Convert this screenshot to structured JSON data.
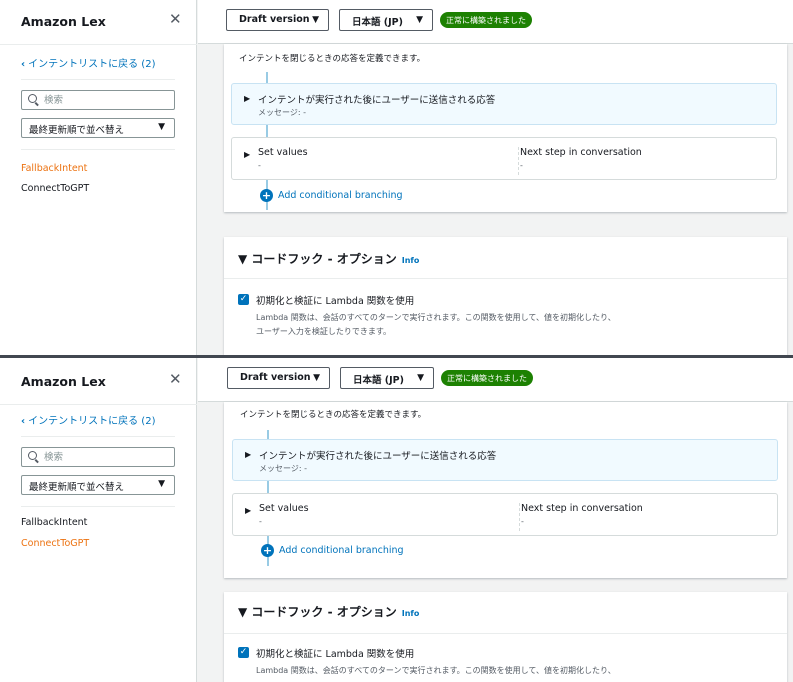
{
  "panels": [
    {
      "sidebar": {
        "title": "Amazon Lex",
        "close": "✕",
        "back_link": "インテントリストに戻る (2)",
        "search_placeholder": "検索",
        "sort_value": "最終更新順で並べ替え",
        "intents": [
          "FallbackIntent",
          "ConnectToGPT"
        ],
        "active_intent": "FallbackIntent"
      },
      "header": {
        "version": "Draft version",
        "language": "日本語 (JP)",
        "status": "正常に構築されました"
      },
      "closing": {
        "description": "インテントを閉じるときの応答を定義できます。",
        "response_title": "インテントが実行された後にユーザーに送信される応答",
        "response_message": "メッセージ: -",
        "set_values_label": "Set values",
        "set_values_value": "-",
        "next_step_label": "Next step in conversation",
        "next_step_value": "-",
        "add_branching": "Add conditional branching"
      },
      "codehook": {
        "title": "コードフック - オプション",
        "info": "Info",
        "checkbox_label": "初期化と検証に Lambda 関数を使用",
        "checkbox_desc_1": "Lambda 関数は、会話のすべてのターンで実行されます。この関数を使用して、値を初期化したり、",
        "checkbox_desc_2": "ユーザー入力を検証したりできます。"
      }
    },
    {
      "sidebar": {
        "title": "Amazon Lex",
        "close": "✕",
        "back_link": "インテントリストに戻る (2)",
        "search_placeholder": "検索",
        "sort_value": "最終更新順で並べ替え",
        "intents": [
          "FallbackIntent",
          "ConnectToGPT"
        ],
        "active_intent": "ConnectToGPT"
      },
      "header": {
        "version": "Draft version",
        "language": "日本語 (JP)",
        "status": "正常に構築されました"
      },
      "closing": {
        "description": "インテントを閉じるときの応答を定義できます。",
        "response_title": "インテントが実行された後にユーザーに送信される応答",
        "response_message": "メッセージ: -",
        "set_values_label": "Set values",
        "set_values_value": "-",
        "next_step_label": "Next step in conversation",
        "next_step_value": "-",
        "add_branching": "Add conditional branching"
      },
      "codehook": {
        "title": "コードフック - オプション",
        "info": "Info",
        "checkbox_label": "初期化と検証に Lambda 関数を使用",
        "checkbox_desc_1": "Lambda 関数は、会話のすべてのターンで実行されます。この関数を使用して、値を初期化したり、",
        "checkbox_desc_2": ""
      }
    }
  ]
}
